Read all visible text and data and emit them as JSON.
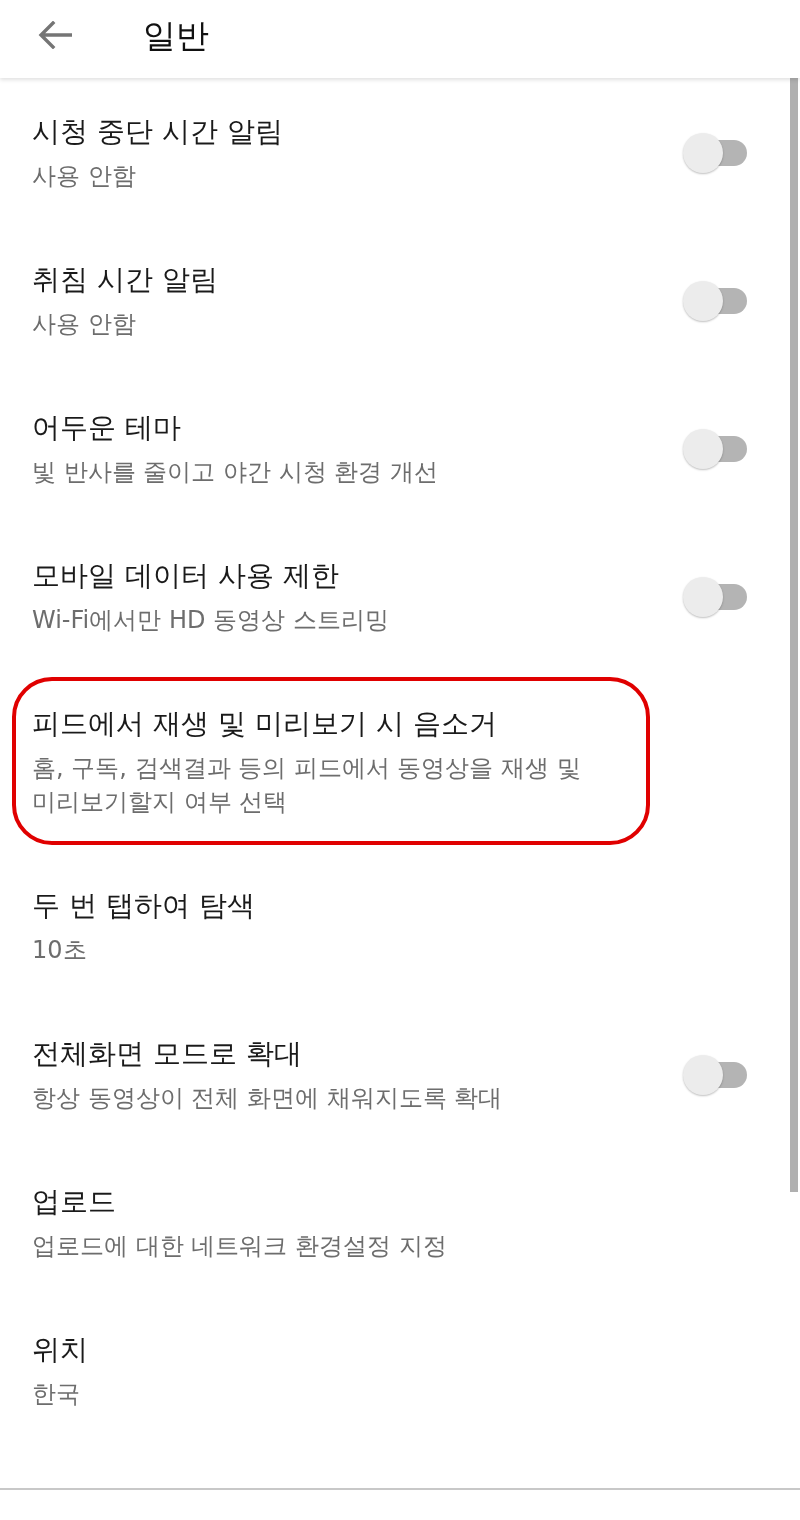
{
  "header": {
    "title": "일반"
  },
  "settings": [
    {
      "title": "시청 중단 시간 알림",
      "subtitle": "사용 안함",
      "highlighted": false,
      "toggle": {
        "on": false
      }
    },
    {
      "title": "취침 시간 알림",
      "subtitle": "사용 안함",
      "highlighted": false,
      "toggle": {
        "on": false
      }
    },
    {
      "title": "어두운 테마",
      "subtitle": "빛 반사를 줄이고 야간 시청 환경 개선",
      "highlighted": false,
      "toggle": {
        "on": false
      }
    },
    {
      "title": "모바일 데이터 사용 제한",
      "subtitle": "Wi-Fi에서만 HD 동영상 스트리밍",
      "highlighted": false,
      "toggle": {
        "on": false
      }
    },
    {
      "title": "피드에서 재생 및 미리보기 시 음소거",
      "subtitle": "홈, 구독, 검색결과 등의 피드에서 동영상을 재생 및 미리보기할지 여부 선택",
      "highlighted": true
    },
    {
      "title": "두 번 탭하여 탐색",
      "subtitle": "10초",
      "highlighted": false
    },
    {
      "title": "전체화면 모드로 확대",
      "subtitle": "항상 동영상이 전체 화면에 채워지도록 확대",
      "highlighted": false,
      "toggle": {
        "on": false
      }
    },
    {
      "title": "업로드",
      "subtitle": "업로드에 대한 네트워크 환경설정 지정",
      "highlighted": false
    },
    {
      "title": "위치",
      "subtitle": "한국",
      "highlighted": false
    }
  ]
}
